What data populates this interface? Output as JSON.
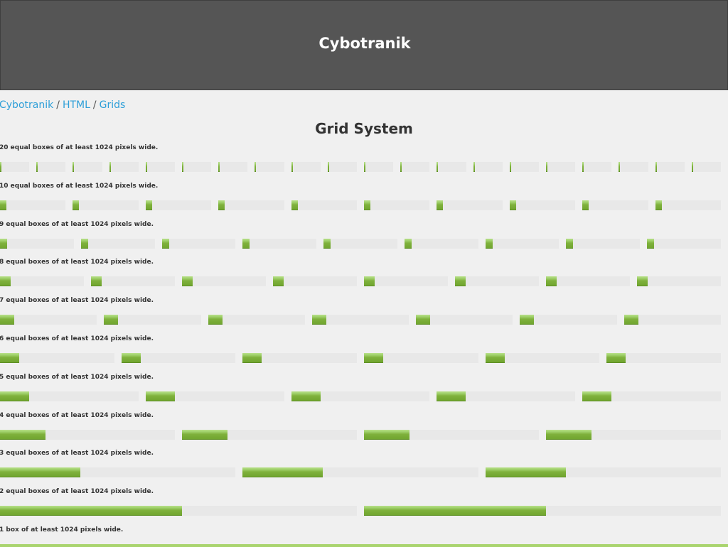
{
  "header": {
    "title": "Cybotranik"
  },
  "breadcrumb": {
    "items": [
      "Cybotranik",
      "HTML",
      "Grids"
    ],
    "separator": "/"
  },
  "page_title": "Grid System",
  "grids": [
    {
      "label": "20 equal boxes of at least 1024 pixels wide.",
      "count": 20,
      "fill": 0.04
    },
    {
      "label": "10 equal boxes of at least 1024 pixels wide.",
      "count": 10,
      "fill": 0.09
    },
    {
      "label": "9 equal boxes of at least 1024 pixels wide.",
      "count": 9,
      "fill": 0.09
    },
    {
      "label": "8 equal boxes of at least 1024 pixels wide.",
      "count": 8,
      "fill": 0.12
    },
    {
      "label": "7 equal boxes of at least 1024 pixels wide.",
      "count": 7,
      "fill": 0.14
    },
    {
      "label": "6 equal boxes of at least 1024 pixels wide.",
      "count": 6,
      "fill": 0.16
    },
    {
      "label": "5 equal boxes of at least 1024 pixels wide.",
      "count": 5,
      "fill": 0.2
    },
    {
      "label": "4 equal boxes of at least 1024 pixels wide.",
      "count": 4,
      "fill": 0.25
    },
    {
      "label": "3 equal boxes of at least 1024 pixels wide.",
      "count": 3,
      "fill": 0.33
    },
    {
      "label": "2 equal boxes of at least 1024 pixels wide.",
      "count": 2,
      "fill": 0.5
    },
    {
      "label": "1 box of at least 1024 pixels wide.",
      "count": 1,
      "fill": 1.0
    }
  ],
  "colors": {
    "header_bg": "#555555",
    "link": "#2e9fd8",
    "box_track": "#e8e8e8",
    "box_fill": "#7fb13c"
  }
}
